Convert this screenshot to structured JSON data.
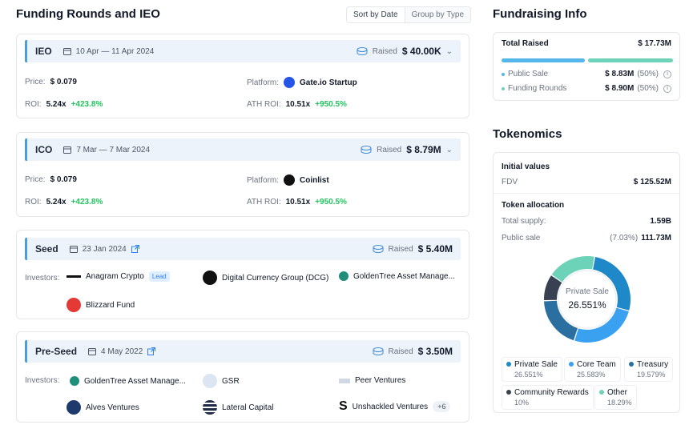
{
  "left": {
    "title": "Funding Rounds and IEO",
    "sort": {
      "by_date": "Sort by Date",
      "by_type": "Group by Type"
    }
  },
  "rounds": [
    {
      "type": "IEO",
      "date": "10 Apr — 11 Apr 2024",
      "raised_label": "Raised",
      "raised": "$ 40.00K",
      "price_label": "Price:",
      "price": "$ 0.079",
      "platform_label": "Platform:",
      "platform": "Gate.io Startup",
      "roi_label": "ROI:",
      "roi": "5.24x",
      "roi_change": "+423.8%",
      "ath_label": "ATH ROI:",
      "ath": "10.51x",
      "ath_change": "+950.5%"
    },
    {
      "type": "ICO",
      "date": "7 Mar — 7 Mar 2024",
      "raised_label": "Raised",
      "raised": "$ 8.79M",
      "price_label": "Price:",
      "price": "$ 0.079",
      "platform_label": "Platform:",
      "platform": "Coinlist",
      "roi_label": "ROI:",
      "roi": "5.24x",
      "roi_change": "+423.8%",
      "ath_label": "ATH ROI:",
      "ath": "10.51x",
      "ath_change": "+950.5%"
    }
  ],
  "seed": {
    "type": "Seed",
    "date": "23 Jan 2024",
    "raised_label": "Raised",
    "raised": "$ 5.40M",
    "investors_label": "Investors:",
    "investors": [
      "Anagram Crypto",
      "Digital Currency Group (DCG)",
      "GoldenTree Asset Manage...",
      "Blizzard Fund"
    ],
    "lead": "Lead"
  },
  "preseed": {
    "type": "Pre-Seed",
    "date": "4 May 2022",
    "raised_label": "Raised",
    "raised": "$ 3.50M",
    "investors_label": "Investors:",
    "investors": [
      "GoldenTree Asset Manage...",
      "GSR",
      "Peer Ventures",
      "Alves Ventures",
      "Lateral Capital",
      "Unshackled Ventures"
    ],
    "more": "+6"
  },
  "fundraising": {
    "title": "Fundraising Info",
    "total_label": "Total Raised",
    "total": "$ 17.73M",
    "public_label": "Public Sale",
    "public": "$ 8.83M",
    "public_pct": "(50%)",
    "funding_label": "Funding Rounds",
    "funding": "$ 8.90M",
    "funding_pct": "(50%)"
  },
  "tokenomics": {
    "title": "Tokenomics",
    "initial_label": "Initial values",
    "fdv_label": "FDV",
    "fdv": "$ 125.52M",
    "alloc_label": "Token allocation",
    "supply_label": "Total supply:",
    "supply": "1.59B",
    "public_label": "Public sale",
    "public_pct": "(7.03%)",
    "public": "111.73M",
    "center_label": "Private Sale",
    "center_value": "26.551%"
  },
  "allocation": [
    {
      "name": "Private Sale",
      "pct": "26.551%",
      "value": 26.551,
      "color": "#1e88c8"
    },
    {
      "name": "Core Team",
      "pct": "25.583%",
      "value": 25.583,
      "color": "#3aa0f0"
    },
    {
      "name": "Treasury",
      "pct": "19.579%",
      "value": 19.579,
      "color": "#2a6fa0"
    },
    {
      "name": "Community Rewards",
      "pct": "10%",
      "value": 10,
      "color": "#374151"
    },
    {
      "name": "Other",
      "pct": "18.29%",
      "value": 18.29,
      "color": "#6dd3b8"
    }
  ]
}
